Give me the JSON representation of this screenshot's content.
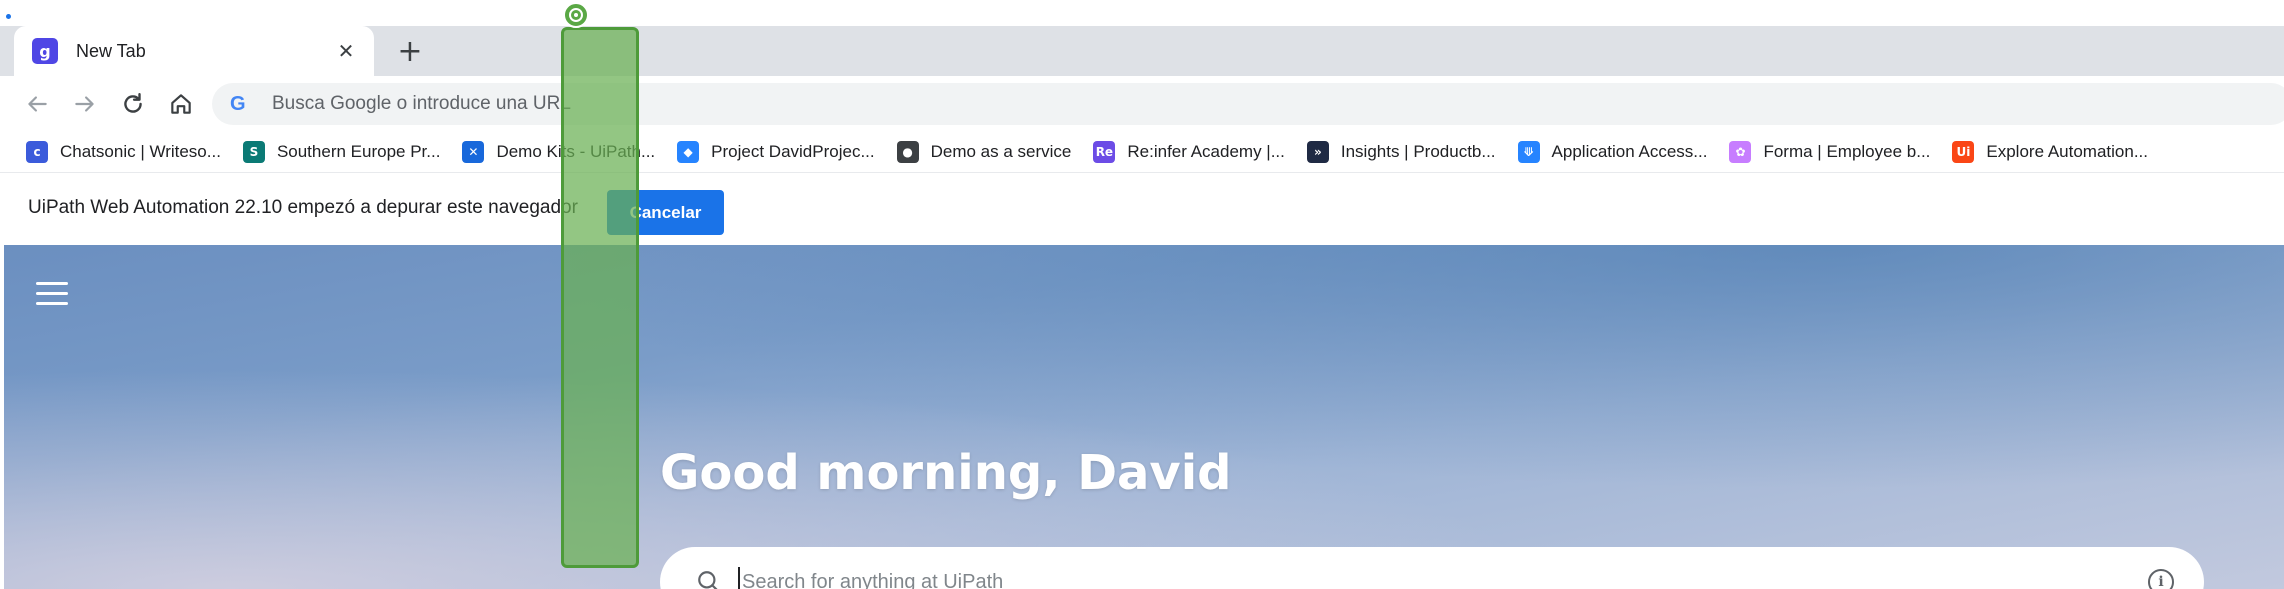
{
  "browser": {
    "tab": {
      "title": "New Tab",
      "favicon": "uipath-g-icon",
      "close_glyph": "✕"
    },
    "new_tab_glyph": "+",
    "omnibox": {
      "placeholder": "Busca Google o introduce una URL",
      "icon": "G"
    }
  },
  "bookmarks": [
    {
      "label": "Chatsonic | Writeso...",
      "icon": "chatsonic-icon",
      "color": "#3b5bdb",
      "glyph": "c"
    },
    {
      "label": "Southern Europe Pr...",
      "icon": "sharepoint-icon",
      "color": "#0b7a75",
      "glyph": "S"
    },
    {
      "label": "Demo Kits - UiPath...",
      "icon": "confluence-icon",
      "color": "#1868db",
      "glyph": "✕"
    },
    {
      "label": "Project DavidProjec...",
      "icon": "jira-diamond-icon",
      "color": "#2684ff",
      "glyph": "◆"
    },
    {
      "label": "Demo as a service",
      "icon": "globe-icon",
      "color": "#3c4043",
      "glyph": "●"
    },
    {
      "label": "Re:infer Academy |...",
      "icon": "reinfer-icon",
      "color": "#6c4ce6",
      "glyph": "Re"
    },
    {
      "label": "Insights | Productb...",
      "icon": "productboard-icon",
      "color": "#1f2a44",
      "glyph": "»"
    },
    {
      "label": "Application Access...",
      "icon": "jira-icon",
      "color": "#2684ff",
      "glyph": "⟱"
    },
    {
      "label": "Forma | Employee b...",
      "icon": "forma-icon",
      "color": "#c77dff",
      "glyph": "✿"
    },
    {
      "label": "Explore Automation...",
      "icon": "uipath-icon",
      "color": "#fa4616",
      "glyph": "Ui"
    }
  ],
  "infobar": {
    "message": "UiPath Web Automation 22.10 empezó a depurar este navegador",
    "cancel_label": "Cancelar"
  },
  "page": {
    "greeting": "Good morning, David",
    "search_placeholder": "Search for anything at UiPath"
  },
  "colors": {
    "accent": "#1a73e8",
    "selection": "#6ab053"
  }
}
